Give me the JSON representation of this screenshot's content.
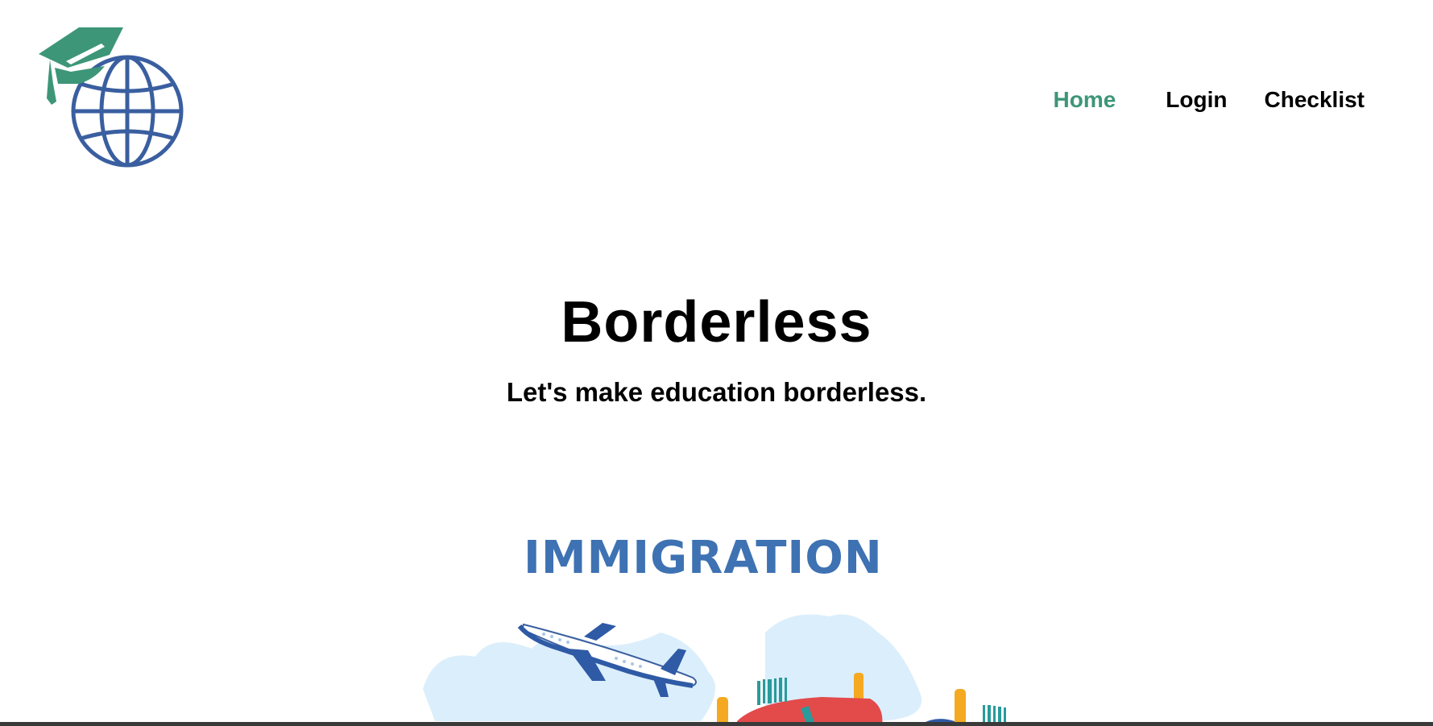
{
  "brand": {
    "logo_icon": "graduation-cap-globe-icon",
    "colors": {
      "cap": "#3d9677",
      "globe": "#3a5fa0"
    }
  },
  "nav": {
    "home": "Home",
    "login": "Login",
    "checklist": "Checklist",
    "active_color": "#3d9677"
  },
  "hero": {
    "title": "Borderless",
    "subtitle": "Let's make education borderless."
  },
  "illustration": {
    "title": "IMMIGRATION",
    "icon": "airplane-luggage-illustration",
    "title_color": "#3e72b3"
  }
}
